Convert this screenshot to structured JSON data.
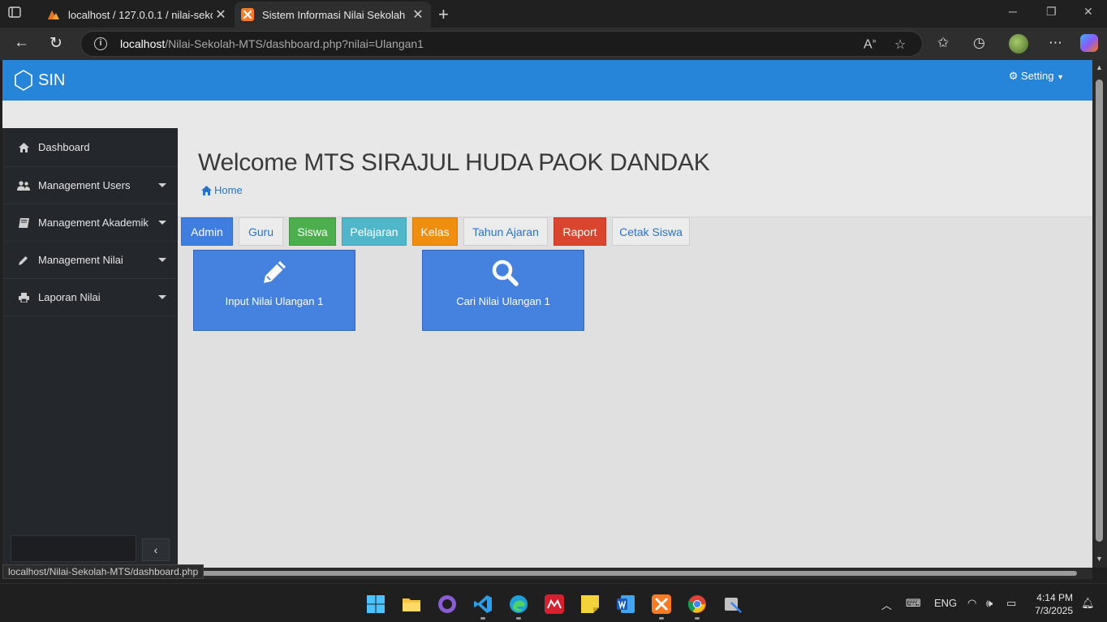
{
  "browser": {
    "tabs": [
      {
        "title": "localhost / 127.0.0.1 / nilai-sekolah"
      },
      {
        "title": "Sistem Informasi Nilai Sekolah"
      }
    ],
    "address": {
      "host": "localhost",
      "path": "/Nilai-Sekolah-MTS/dashboard.php?nilai=Ulangan1"
    },
    "status_url": "localhost/Nilai-Sekolah-MTS/dashboard.php"
  },
  "app": {
    "brand": "SIN",
    "setting_label": "Setting",
    "accent": "#2684d9"
  },
  "sidebar": {
    "items": [
      {
        "label": "Dashboard",
        "icon": "home-icon"
      },
      {
        "label": "Management Users",
        "icon": "users-icon"
      },
      {
        "label": "Management Akademik",
        "icon": "book-icon"
      },
      {
        "label": "Management Nilai",
        "icon": "pencil-icon"
      },
      {
        "label": "Laporan Nilai",
        "icon": "print-icon"
      }
    ]
  },
  "page": {
    "title": "Welcome MTS SIRAJUL HUDA PAOK DANDAK",
    "breadcrumb": "Home"
  },
  "quick_buttons": {
    "admin": "Admin",
    "guru": "Guru",
    "siswa": "Siswa",
    "pelajaran": "Pelajaran",
    "kelas": "Kelas",
    "tahun": "Tahun Ajaran",
    "raport": "Raport",
    "cetak": "Cetak Siswa"
  },
  "tiles": {
    "input": "Input Nilai Ulangan 1",
    "cari": "Cari Nilai Ulangan 1"
  },
  "taskbar": {
    "lang": "ENG",
    "time": "4:14 PM",
    "date": "7/3/2025"
  }
}
